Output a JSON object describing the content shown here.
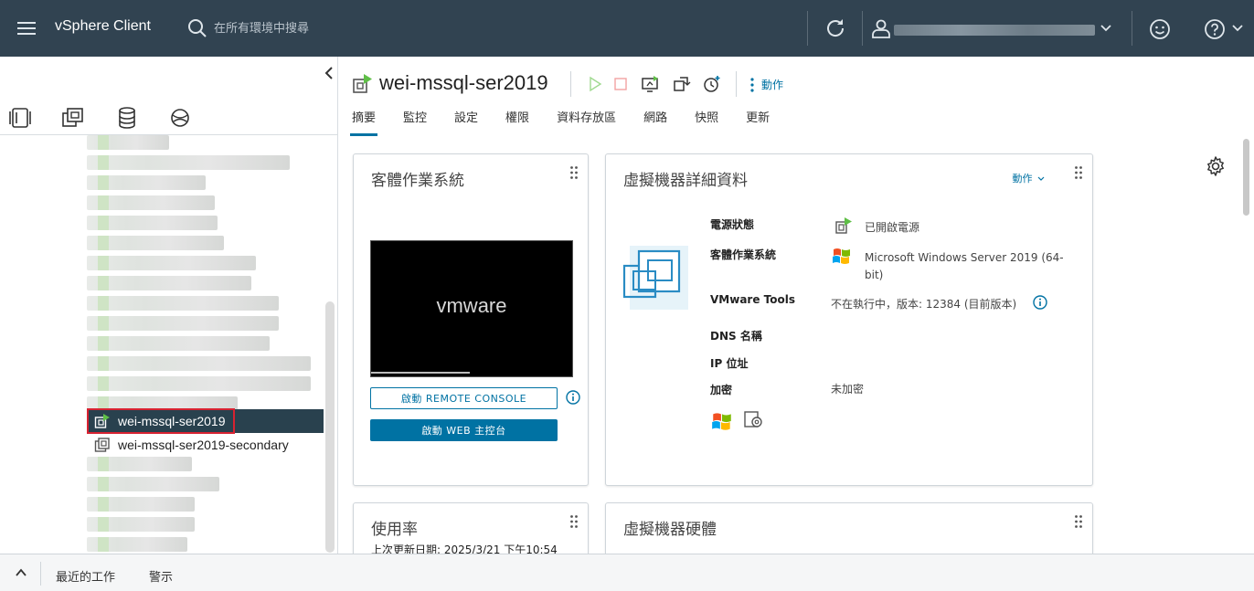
{
  "header": {
    "brand": "vSphere Client",
    "search_placeholder": "在所有環境中搜尋"
  },
  "tree": {
    "items": [
      {
        "label": "wei-mssql-ser2019",
        "selected": true
      },
      {
        "label": "wei-mssql-ser2019-secondary",
        "selected": false
      }
    ]
  },
  "vm": {
    "name": "wei-mssql-ser2019",
    "actions_label": "動作"
  },
  "tabs": [
    "摘要",
    "監控",
    "設定",
    "權限",
    "資料存放區",
    "網路",
    "快照",
    "更新"
  ],
  "guest_os_card": {
    "title": "客體作業系統",
    "console_logo": "vmware",
    "remote_console_label": "啟動 REMOTE CONSOLE",
    "web_console_label": "啟動 WEB 主控台"
  },
  "vm_details_card": {
    "title": "虛擬機器詳細資料",
    "actions_label": "動作",
    "rows": [
      {
        "label": "電源狀態",
        "value": "已開啟電源"
      },
      {
        "label": "客體作業系統",
        "value": "Microsoft Windows Server 2019 (64-bit)"
      },
      {
        "label": "VMware Tools",
        "value": "不在執行中，版本: 12384 (目前版本)"
      },
      {
        "label": "DNS 名稱",
        "value": ""
      },
      {
        "label": "IP 位址",
        "value": ""
      },
      {
        "label": "加密",
        "value": "未加密"
      }
    ]
  },
  "usage_card": {
    "title": "使用率",
    "last_updated": "上次更新日期: 2025/3/21 下午10:54"
  },
  "vm_hardware_card": {
    "title": "虛擬機器硬體"
  },
  "bottom": {
    "recent_tasks": "最近的工作",
    "alarms": "警示"
  },
  "colors": {
    "header_bg": "#314351",
    "accent": "#0072a3",
    "selected_bg": "#29414e",
    "highlight_outline": "#d82231"
  }
}
